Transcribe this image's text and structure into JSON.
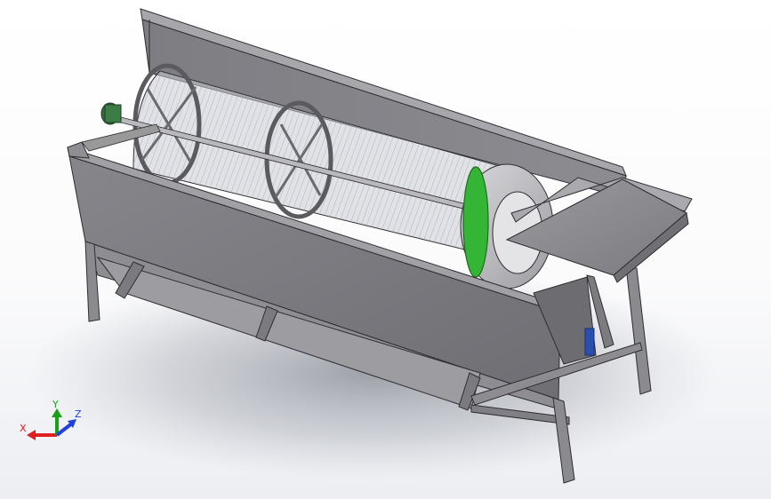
{
  "viewport": {
    "background_top": "#ffffff",
    "background_bottom": "#eceef2"
  },
  "model": {
    "subject": "drum-screen-machine",
    "colors": {
      "sheet_metal_light": "#8f8f94",
      "sheet_metal_mid": "#76767b",
      "sheet_metal_dark": "#5c5c60",
      "edge": "#2e2e32",
      "mesh": "#9aa0aa",
      "green_ring": "#35b535",
      "motor": "#2f6f3a",
      "blue_part": "#2a4fb0"
    }
  },
  "triad": {
    "x_label": "X",
    "y_label": "Y",
    "z_label": "Z",
    "x_color": "#e02020",
    "y_color": "#18a018",
    "z_color": "#2040e0"
  }
}
